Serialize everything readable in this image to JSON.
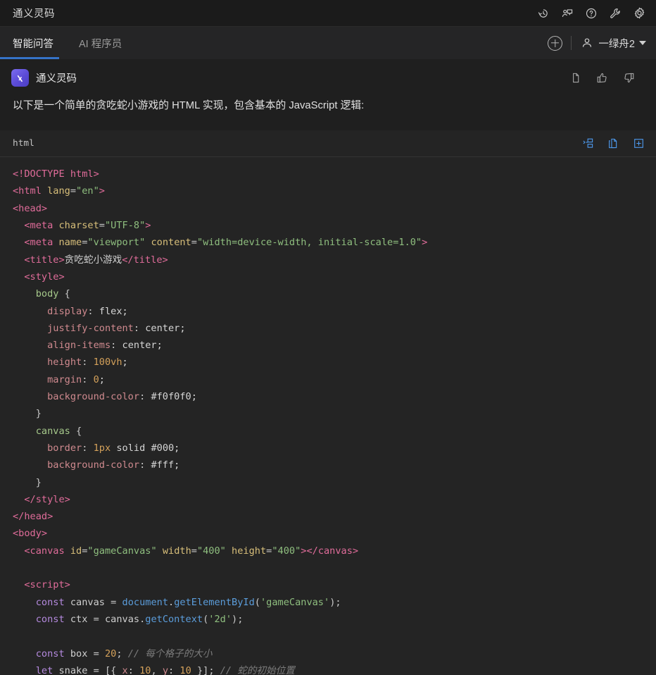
{
  "titlebar": {
    "title": "通义灵码",
    "icons": [
      {
        "name": "history-icon"
      },
      {
        "name": "feedback-person-icon"
      },
      {
        "name": "help-question-icon"
      },
      {
        "name": "wrench-icon"
      },
      {
        "name": "settings-gear-icon"
      }
    ]
  },
  "tabbar": {
    "tabs": [
      {
        "label": "智能问答",
        "active": true
      },
      {
        "label": "AI 程序员",
        "active": false
      }
    ],
    "new_chat_icon": "plus-circle-icon",
    "user": {
      "name": "一绿舟2",
      "avatar_icon": "person-icon",
      "caret_icon": "chevron-down-icon"
    }
  },
  "message": {
    "brand": "通义灵码",
    "actions": [
      {
        "name": "copy-icon"
      },
      {
        "name": "thumbs-up-icon"
      },
      {
        "name": "thumbs-down-icon"
      }
    ],
    "text": "以下是一个简单的贪吃蛇小游戏的 HTML 实现，包含基本的 JavaScript 逻辑:"
  },
  "codeblock": {
    "language": "html",
    "actions": [
      {
        "name": "diff-compare-icon"
      },
      {
        "name": "copy-code-icon"
      },
      {
        "name": "insert-code-icon"
      }
    ],
    "lines": [
      [
        {
          "t": "tag",
          "v": "<!DOCTYPE html>"
        }
      ],
      [
        {
          "t": "tag",
          "v": "<html "
        },
        {
          "t": "attr",
          "v": "lang"
        },
        {
          "t": "punc",
          "v": "="
        },
        {
          "t": "str",
          "v": "\"en\""
        },
        {
          "t": "tag",
          "v": ">"
        }
      ],
      [
        {
          "t": "tag",
          "v": "<head>"
        }
      ],
      [
        {
          "t": "plain",
          "v": "  "
        },
        {
          "t": "tag",
          "v": "<meta "
        },
        {
          "t": "attr",
          "v": "charset"
        },
        {
          "t": "punc",
          "v": "="
        },
        {
          "t": "str",
          "v": "\"UTF-8\""
        },
        {
          "t": "tag",
          "v": ">"
        }
      ],
      [
        {
          "t": "plain",
          "v": "  "
        },
        {
          "t": "tag",
          "v": "<meta "
        },
        {
          "t": "attr",
          "v": "name"
        },
        {
          "t": "punc",
          "v": "="
        },
        {
          "t": "str",
          "v": "\"viewport\""
        },
        {
          "t": "plain",
          "v": " "
        },
        {
          "t": "attr",
          "v": "content"
        },
        {
          "t": "punc",
          "v": "="
        },
        {
          "t": "str",
          "v": "\"width=device-width, initial-scale=1.0\""
        },
        {
          "t": "tag",
          "v": ">"
        }
      ],
      [
        {
          "t": "plain",
          "v": "  "
        },
        {
          "t": "tag",
          "v": "<title>"
        },
        {
          "t": "plain",
          "v": "贪吃蛇小游戏"
        },
        {
          "t": "tag",
          "v": "</title>"
        }
      ],
      [
        {
          "t": "plain",
          "v": "  "
        },
        {
          "t": "tag",
          "v": "<style>"
        }
      ],
      [
        {
          "t": "plain",
          "v": "    "
        },
        {
          "t": "sel",
          "v": "body"
        },
        {
          "t": "punc",
          "v": " {"
        }
      ],
      [
        {
          "t": "plain",
          "v": "      "
        },
        {
          "t": "prop",
          "v": "display"
        },
        {
          "t": "punc",
          "v": ": "
        },
        {
          "t": "val",
          "v": "flex;"
        }
      ],
      [
        {
          "t": "plain",
          "v": "      "
        },
        {
          "t": "prop",
          "v": "justify-content"
        },
        {
          "t": "punc",
          "v": ": "
        },
        {
          "t": "val",
          "v": "center;"
        }
      ],
      [
        {
          "t": "plain",
          "v": "      "
        },
        {
          "t": "prop",
          "v": "align-items"
        },
        {
          "t": "punc",
          "v": ": "
        },
        {
          "t": "val",
          "v": "center;"
        }
      ],
      [
        {
          "t": "plain",
          "v": "      "
        },
        {
          "t": "prop",
          "v": "height"
        },
        {
          "t": "punc",
          "v": ": "
        },
        {
          "t": "num",
          "v": "100vh"
        },
        {
          "t": "val",
          "v": ";"
        }
      ],
      [
        {
          "t": "plain",
          "v": "      "
        },
        {
          "t": "prop",
          "v": "margin"
        },
        {
          "t": "punc",
          "v": ": "
        },
        {
          "t": "num",
          "v": "0"
        },
        {
          "t": "val",
          "v": ";"
        }
      ],
      [
        {
          "t": "plain",
          "v": "      "
        },
        {
          "t": "prop",
          "v": "background-color"
        },
        {
          "t": "punc",
          "v": ": "
        },
        {
          "t": "val",
          "v": "#f0f0f0;"
        }
      ],
      [
        {
          "t": "plain",
          "v": "    "
        },
        {
          "t": "punc",
          "v": "}"
        }
      ],
      [
        {
          "t": "plain",
          "v": "    "
        },
        {
          "t": "sel",
          "v": "canvas"
        },
        {
          "t": "punc",
          "v": " {"
        }
      ],
      [
        {
          "t": "plain",
          "v": "      "
        },
        {
          "t": "prop",
          "v": "border"
        },
        {
          "t": "punc",
          "v": ": "
        },
        {
          "t": "num",
          "v": "1px"
        },
        {
          "t": "val",
          "v": " solid #000;"
        }
      ],
      [
        {
          "t": "plain",
          "v": "      "
        },
        {
          "t": "prop",
          "v": "background-color"
        },
        {
          "t": "punc",
          "v": ": "
        },
        {
          "t": "val",
          "v": "#fff;"
        }
      ],
      [
        {
          "t": "plain",
          "v": "    "
        },
        {
          "t": "punc",
          "v": "}"
        }
      ],
      [
        {
          "t": "plain",
          "v": "  "
        },
        {
          "t": "tag",
          "v": "</style>"
        }
      ],
      [
        {
          "t": "tag",
          "v": "</head>"
        }
      ],
      [
        {
          "t": "tag",
          "v": "<body>"
        }
      ],
      [
        {
          "t": "plain",
          "v": "  "
        },
        {
          "t": "tag",
          "v": "<canvas "
        },
        {
          "t": "attr",
          "v": "id"
        },
        {
          "t": "punc",
          "v": "="
        },
        {
          "t": "str",
          "v": "\"gameCanvas\""
        },
        {
          "t": "plain",
          "v": " "
        },
        {
          "t": "attr",
          "v": "width"
        },
        {
          "t": "punc",
          "v": "="
        },
        {
          "t": "str",
          "v": "\"400\""
        },
        {
          "t": "plain",
          "v": " "
        },
        {
          "t": "attr",
          "v": "height"
        },
        {
          "t": "punc",
          "v": "="
        },
        {
          "t": "str",
          "v": "\"400\""
        },
        {
          "t": "tag",
          "v": "></canvas>"
        }
      ],
      [
        {
          "t": "plain",
          "v": ""
        }
      ],
      [
        {
          "t": "plain",
          "v": "  "
        },
        {
          "t": "tag",
          "v": "<script>"
        }
      ],
      [
        {
          "t": "plain",
          "v": "    "
        },
        {
          "t": "kw",
          "v": "const"
        },
        {
          "t": "plain",
          "v": " canvas "
        },
        {
          "t": "punc",
          "v": "= "
        },
        {
          "t": "fn",
          "v": "document"
        },
        {
          "t": "punc",
          "v": "."
        },
        {
          "t": "fn",
          "v": "getElementById"
        },
        {
          "t": "punc",
          "v": "("
        },
        {
          "t": "str",
          "v": "'gameCanvas'"
        },
        {
          "t": "punc",
          "v": ");"
        }
      ],
      [
        {
          "t": "plain",
          "v": "    "
        },
        {
          "t": "kw",
          "v": "const"
        },
        {
          "t": "plain",
          "v": " ctx "
        },
        {
          "t": "punc",
          "v": "= "
        },
        {
          "t": "plain",
          "v": "canvas"
        },
        {
          "t": "punc",
          "v": "."
        },
        {
          "t": "fn",
          "v": "getContext"
        },
        {
          "t": "punc",
          "v": "("
        },
        {
          "t": "str",
          "v": "'2d'"
        },
        {
          "t": "punc",
          "v": ");"
        }
      ],
      [
        {
          "t": "plain",
          "v": ""
        }
      ],
      [
        {
          "t": "plain",
          "v": "    "
        },
        {
          "t": "kw",
          "v": "const"
        },
        {
          "t": "plain",
          "v": " box "
        },
        {
          "t": "punc",
          "v": "= "
        },
        {
          "t": "num",
          "v": "20"
        },
        {
          "t": "punc",
          "v": "; "
        },
        {
          "t": "cmt",
          "v": "// 每个格子的大小"
        }
      ],
      [
        {
          "t": "plain",
          "v": "    "
        },
        {
          "t": "kw",
          "v": "let"
        },
        {
          "t": "plain",
          "v": " snake "
        },
        {
          "t": "punc",
          "v": "= [{ "
        },
        {
          "t": "prop",
          "v": "x"
        },
        {
          "t": "punc",
          "v": ": "
        },
        {
          "t": "num",
          "v": "10"
        },
        {
          "t": "punc",
          "v": ", "
        },
        {
          "t": "prop",
          "v": "y"
        },
        {
          "t": "punc",
          "v": ": "
        },
        {
          "t": "num",
          "v": "10"
        },
        {
          "t": "punc",
          "v": " }]; "
        },
        {
          "t": "cmt",
          "v": "// 蛇的初始位置"
        }
      ]
    ]
  }
}
